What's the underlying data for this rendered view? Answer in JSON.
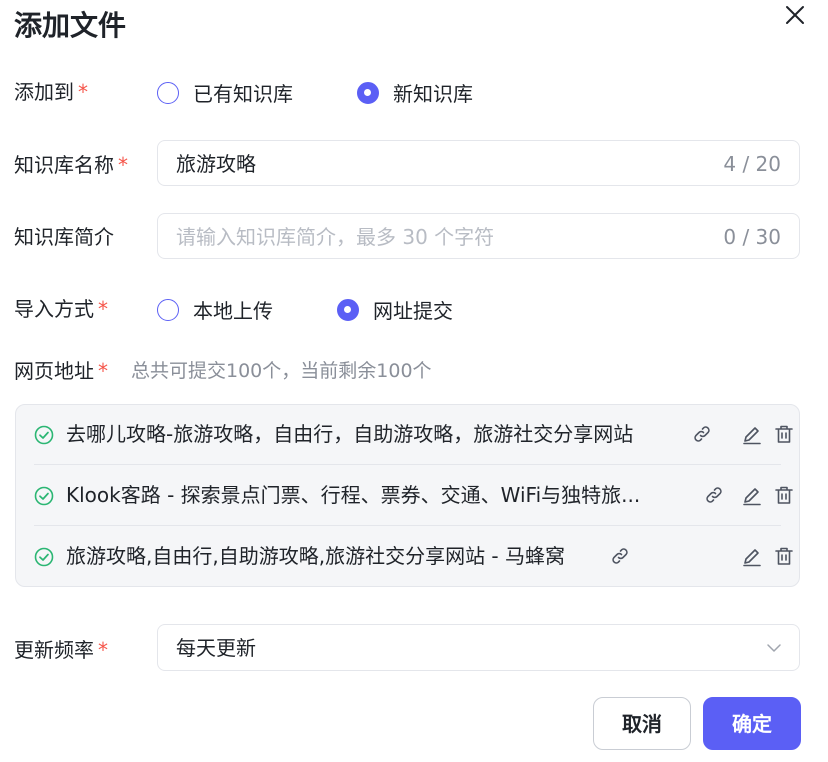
{
  "dialog": {
    "title": "添加文件"
  },
  "add_to": {
    "label": "添加到",
    "required_mark": "*",
    "options": [
      {
        "label": "已有知识库",
        "checked": false
      },
      {
        "label": "新知识库",
        "checked": true
      }
    ]
  },
  "kb_name": {
    "label": "知识库名称",
    "required_mark": "*",
    "value": "旅游攻略",
    "count": "4 / 20"
  },
  "kb_intro": {
    "label": "知识库简介",
    "placeholder": "请输入知识库简介，最多 30 个字符",
    "count": "0 / 30"
  },
  "import_method": {
    "label": "导入方式",
    "required_mark": "*",
    "options": [
      {
        "label": "本地上传",
        "checked": false
      },
      {
        "label": "网址提交",
        "checked": true
      }
    ]
  },
  "web_urls": {
    "label": "网页地址",
    "required_mark": "*",
    "hint": "总共可提交100个，当前剩余100个",
    "items": [
      {
        "title": "去哪儿攻略-旅游攻略，自由行，自助游攻略，旅游社交分享网站"
      },
      {
        "title": "Klook客路 - 探索景点门票、行程、票券、交通、WiFi与独特旅..."
      },
      {
        "title": "旅游攻略,自由行,自助游攻略,旅游社交分享网站 - 马蜂窝"
      }
    ]
  },
  "update_freq": {
    "label": "更新频率",
    "required_mark": "*",
    "value": "每天更新"
  },
  "footer": {
    "cancel_label": "取消",
    "ok_label": "确定"
  },
  "colors": {
    "accent": "#5b5ff5",
    "success": "#2bb673",
    "required": "#f5554a"
  },
  "icons": {
    "close": "close-icon",
    "check": "check-circle-icon",
    "link": "link-icon",
    "edit": "edit-icon",
    "delete": "trash-icon",
    "chevron": "chevron-down-icon"
  }
}
